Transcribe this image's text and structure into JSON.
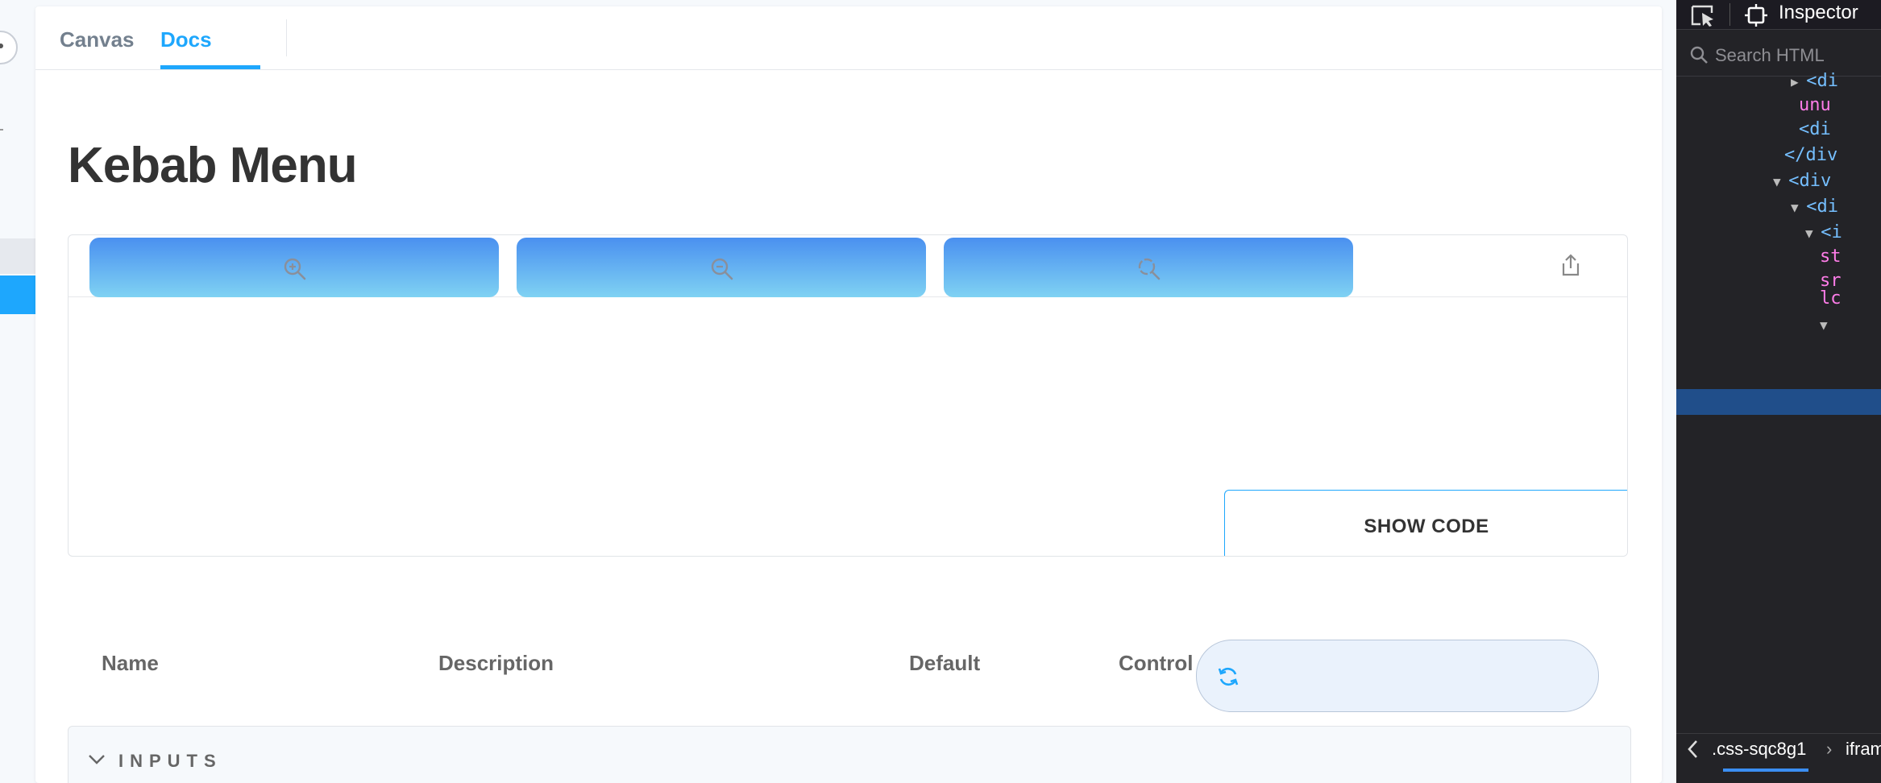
{
  "tabs": {
    "canvas": "Canvas",
    "docs": "Docs"
  },
  "page": {
    "title": "Kebab Menu"
  },
  "preview": {
    "zoom_buttons": [
      "zoom-in-icon",
      "zoom-out-icon",
      "zoom-reset-icon"
    ],
    "share_icon": "share-icon",
    "show_code": "SHOW CODE",
    "accent": "#1ea7fd"
  },
  "args_table": {
    "headers": {
      "name": "Name",
      "description": "Description",
      "default": "Default",
      "control": "Control"
    },
    "reset_icon": "sync-icon",
    "section": "INPUTS"
  },
  "devtools": {
    "tab_label": "Inspector",
    "search_placeholder": "Search HTML",
    "lines": [
      {
        "indent": 140,
        "tri": "▶",
        "text": "<di"
      },
      {
        "indent": 150,
        "tri": "",
        "text": "unu"
      },
      {
        "indent": 150,
        "tri": "",
        "text": "<di"
      },
      {
        "indent": 132,
        "tri": "",
        "text": "</div"
      },
      {
        "indent": 118,
        "tri": "▼",
        "text": "<div"
      },
      {
        "indent": 140,
        "tri": "▼",
        "text": "<di"
      },
      {
        "indent": 158,
        "tri": "▼",
        "text": "<i"
      },
      {
        "indent": 176,
        "tri": "",
        "text": "st"
      },
      {
        "indent": 176,
        "tri": "",
        "text": "sr"
      },
      {
        "indent": 176,
        "tri": "",
        "text": "lc"
      },
      {
        "indent": 176,
        "tri": "▼",
        "text": ""
      }
    ],
    "breadcrumb": [
      ".css-sqc8g1",
      "ifram"
    ]
  }
}
